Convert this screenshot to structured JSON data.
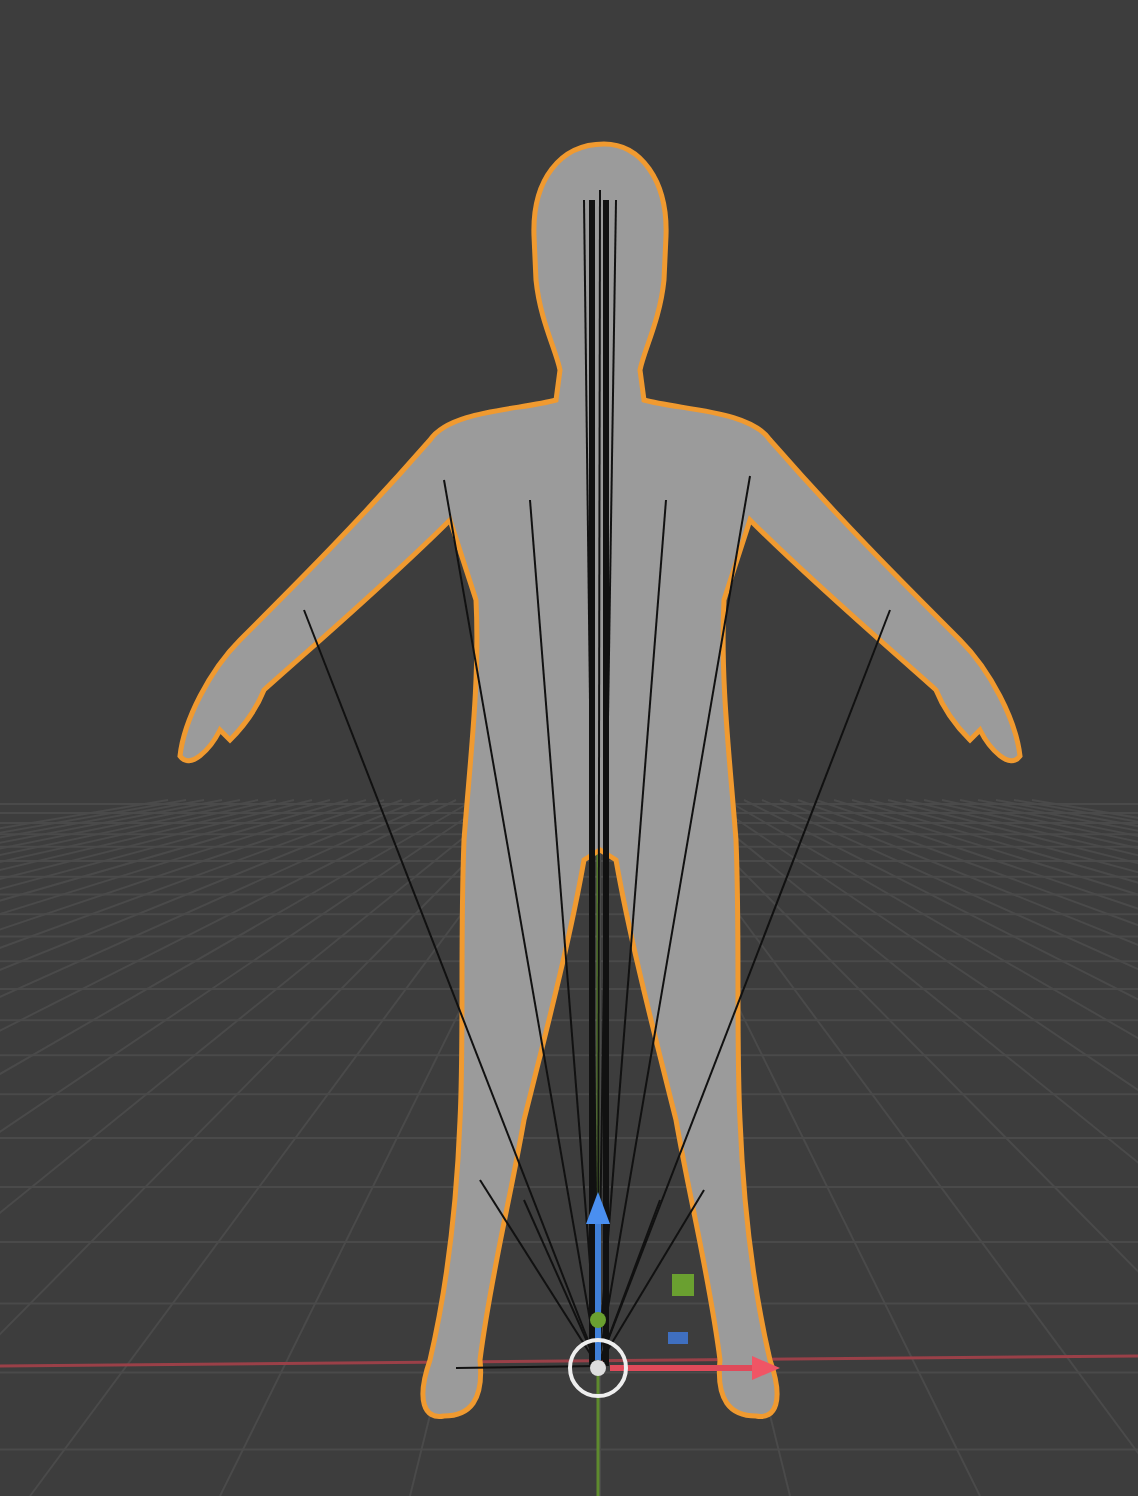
{
  "scene": {
    "mesh": {
      "selected": true
    }
  }
}
